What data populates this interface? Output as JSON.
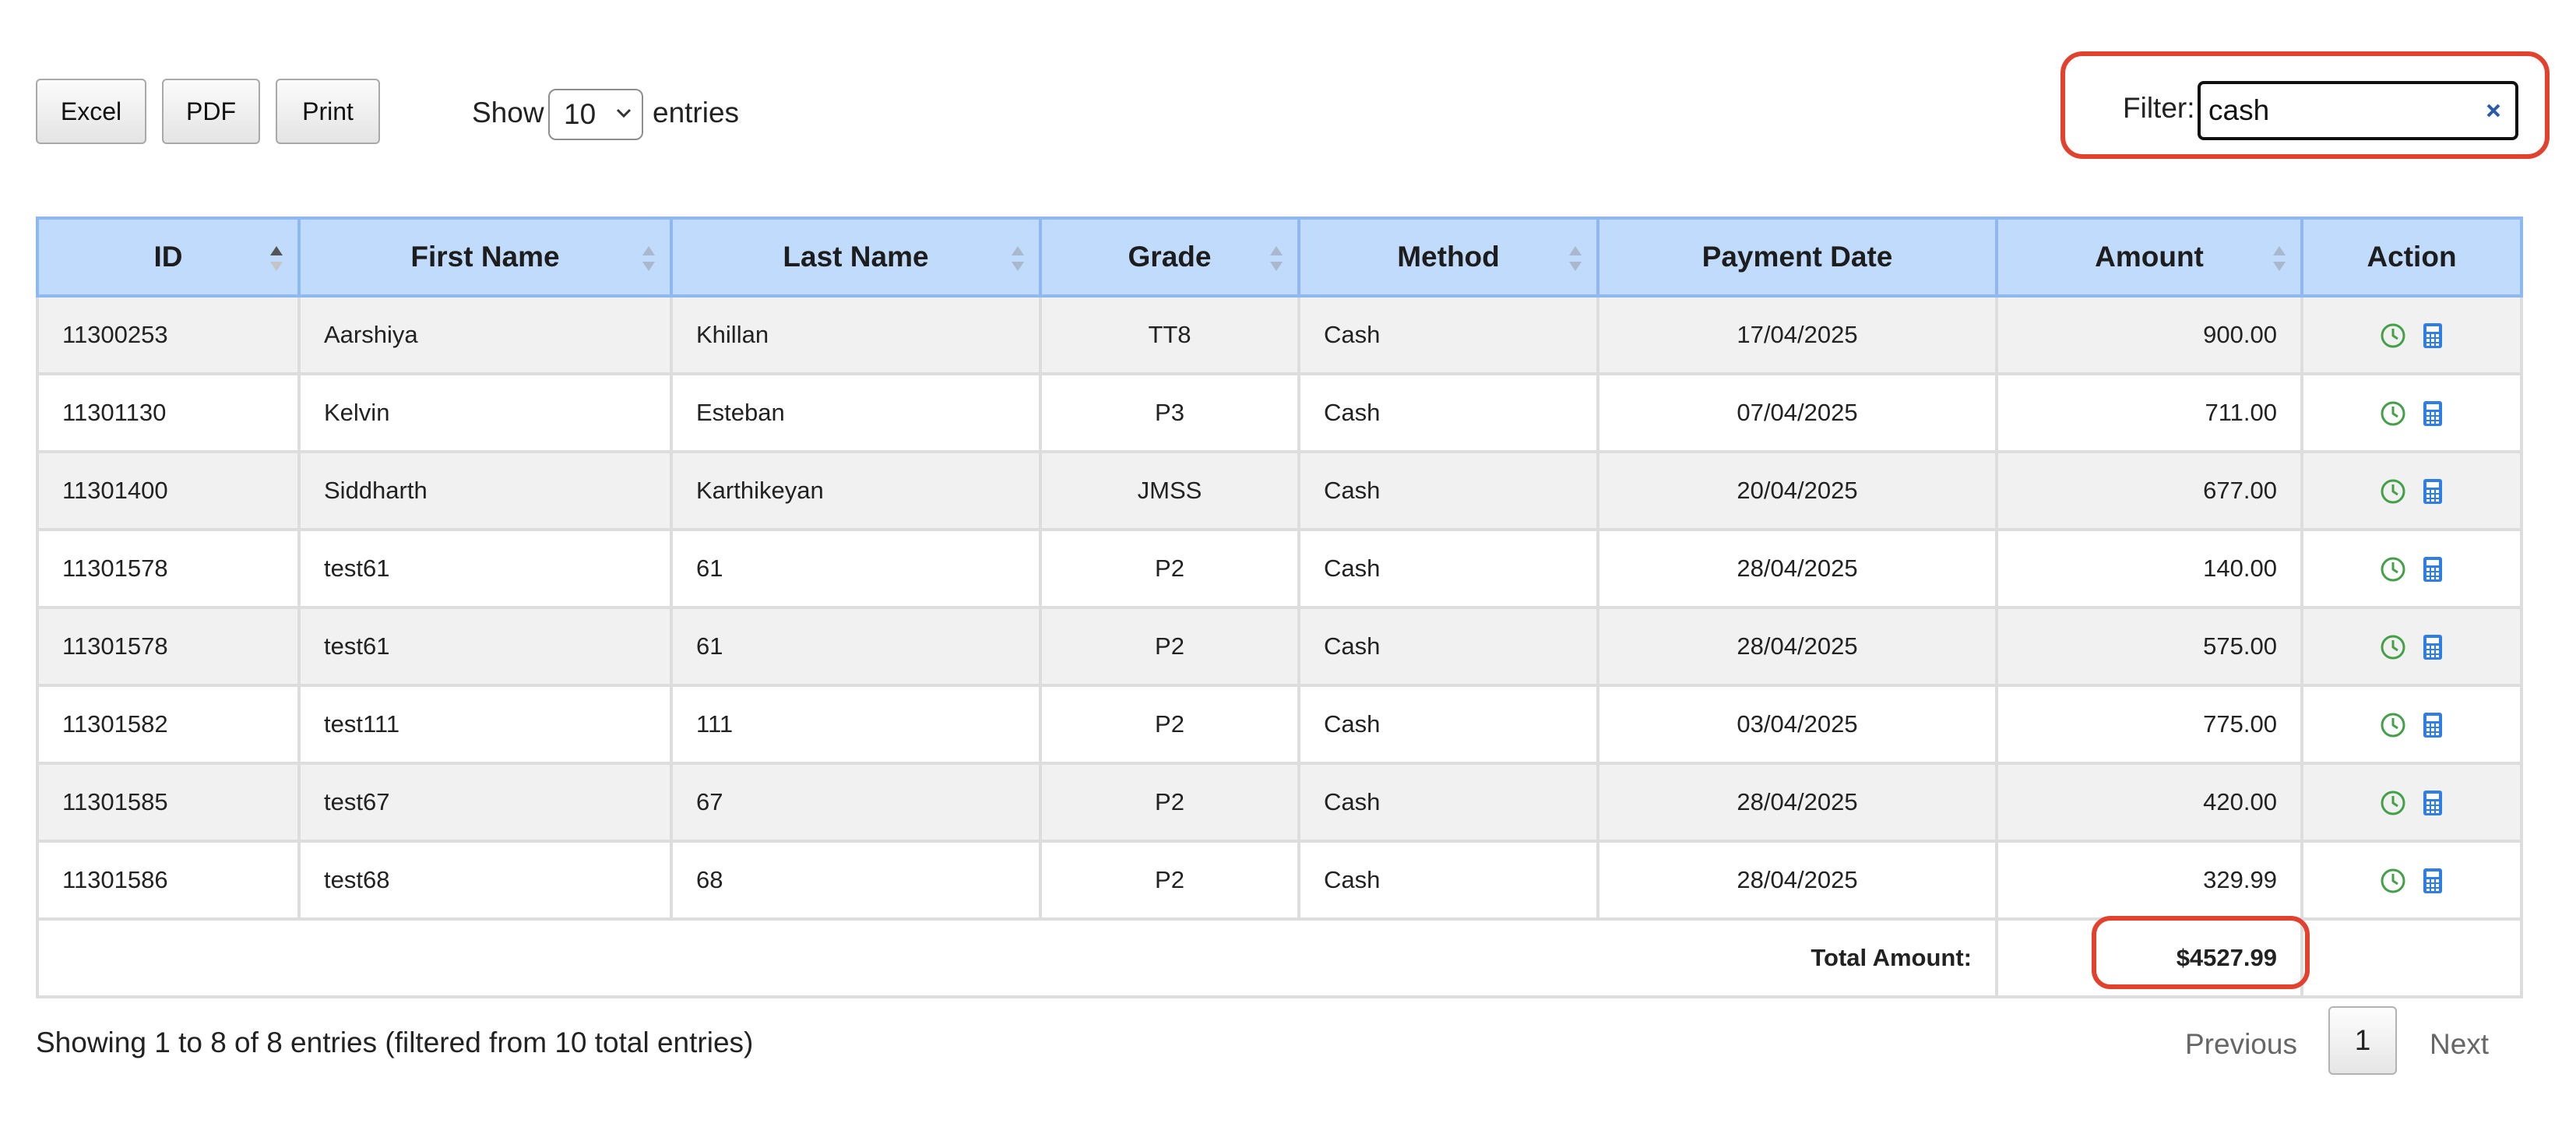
{
  "toolbar": {
    "buttons": {
      "excel": "Excel",
      "pdf": "PDF",
      "print": "Print"
    },
    "show_label": "Show",
    "page_length": "10",
    "entries_label": "entries"
  },
  "filter": {
    "label": "Filter:",
    "value": "cash"
  },
  "table": {
    "columns": [
      "ID",
      "First Name",
      "Last Name",
      "Grade",
      "Method",
      "Payment Date",
      "Amount",
      "Action"
    ],
    "rows": [
      {
        "id": "11300253",
        "first_name": "Aarshiya",
        "last_name": "Khillan",
        "grade": "TT8",
        "method": "Cash",
        "payment_date": "17/04/2025",
        "amount": "900.00"
      },
      {
        "id": "11301130",
        "first_name": "Kelvin",
        "last_name": "Esteban",
        "grade": "P3",
        "method": "Cash",
        "payment_date": "07/04/2025",
        "amount": "711.00"
      },
      {
        "id": "11301400",
        "first_name": "Siddharth",
        "last_name": "Karthikeyan",
        "grade": "JMSS",
        "method": "Cash",
        "payment_date": "20/04/2025",
        "amount": "677.00"
      },
      {
        "id": "11301578",
        "first_name": "test61",
        "last_name": "61",
        "grade": "P2",
        "method": "Cash",
        "payment_date": "28/04/2025",
        "amount": "140.00"
      },
      {
        "id": "11301578",
        "first_name": "test61",
        "last_name": "61",
        "grade": "P2",
        "method": "Cash",
        "payment_date": "28/04/2025",
        "amount": "575.00"
      },
      {
        "id": "11301582",
        "first_name": "test111",
        "last_name": "111",
        "grade": "P2",
        "method": "Cash",
        "payment_date": "03/04/2025",
        "amount": "775.00"
      },
      {
        "id": "11301585",
        "first_name": "test67",
        "last_name": "67",
        "grade": "P2",
        "method": "Cash",
        "payment_date": "28/04/2025",
        "amount": "420.00"
      },
      {
        "id": "11301586",
        "first_name": "test68",
        "last_name": "68",
        "grade": "P2",
        "method": "Cash",
        "payment_date": "28/04/2025",
        "amount": "329.99"
      }
    ],
    "footer": {
      "label": "Total Amount:",
      "value": "$4527.99"
    }
  },
  "info": "Showing 1 to 8 of 8 entries (filtered from 10 total entries)",
  "pagination": {
    "previous": "Previous",
    "current": "1",
    "next": "Next"
  },
  "icons": {
    "history": "clock-icon",
    "receipt": "calculator-icon"
  },
  "colors": {
    "header_bg": "#c0dbfb",
    "header_border": "#8db8f0",
    "total_text": "#2f7ee8",
    "highlight_border": "#e2412e",
    "clock_icon": "#43a047",
    "calculator_icon": "#2f7ee8"
  }
}
